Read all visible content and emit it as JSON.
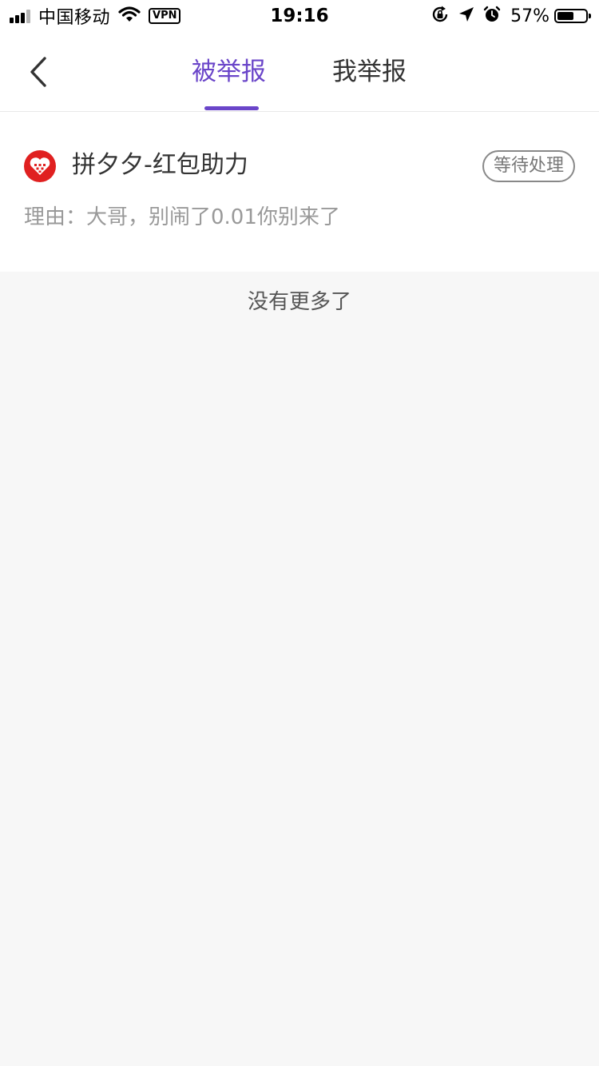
{
  "status_bar": {
    "carrier": "中国移动",
    "vpn": "VPN",
    "time": "19:16",
    "battery": "57%"
  },
  "nav": {
    "tabs": [
      {
        "label": "被举报",
        "active": true
      },
      {
        "label": "我举报",
        "active": false
      }
    ],
    "accent_color": "#6a45c9"
  },
  "reports": [
    {
      "app_name": "拼夕夕-红包助力",
      "status": "等待处理",
      "reason": "理由：大哥，别闹了0.01你别来了",
      "logo_color": "#e02020"
    }
  ],
  "footer": {
    "no_more": "没有更多了"
  }
}
